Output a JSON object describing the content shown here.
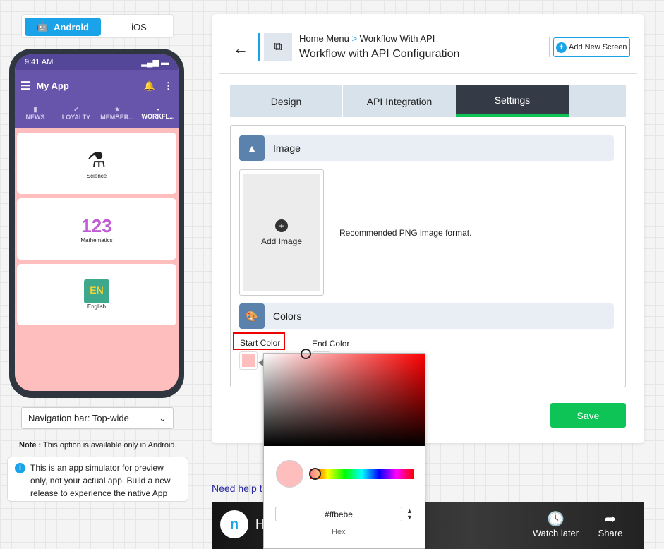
{
  "os": {
    "android": "Android",
    "ios": "iOS"
  },
  "phone": {
    "time": "9:41 AM",
    "app_title": "My App",
    "tabs": [
      "NEWS",
      "LOYALTY",
      "MEMBER...",
      "WORKFL..."
    ],
    "cards": [
      "Science",
      "Mathematics",
      "English"
    ]
  },
  "nav_select": "Navigation bar: Top-wide",
  "note": {
    "label": "Note :",
    "text": " This option is available only in Android."
  },
  "info": "This is an app simulator for preview only, not your actual app. Build a new release to experience the native App",
  "header": {
    "breadcrumb_home": "Home Menu",
    "breadcrumb_sep": ">",
    "breadcrumb_current": "Workflow With API",
    "title": "Workflow with API Configuration",
    "add_screen": "Add New Screen"
  },
  "tabs": [
    "Design",
    "API Integration",
    "Settings"
  ],
  "image": {
    "title": "Image",
    "add": "Add Image",
    "hint": "Recommended PNG image format."
  },
  "colors": {
    "title": "Colors",
    "start": "Start Color",
    "end": "End Color",
    "start_value": "#ffbebe"
  },
  "picker": {
    "hex": "#ffbebe",
    "hex_label": "Hex"
  },
  "save": "Save",
  "help": "Need help t",
  "video": {
    "title": "H",
    "watch_later": "Watch later",
    "share": "Share"
  },
  "accent": "#1aa3e8",
  "save_color": "#0fc456"
}
